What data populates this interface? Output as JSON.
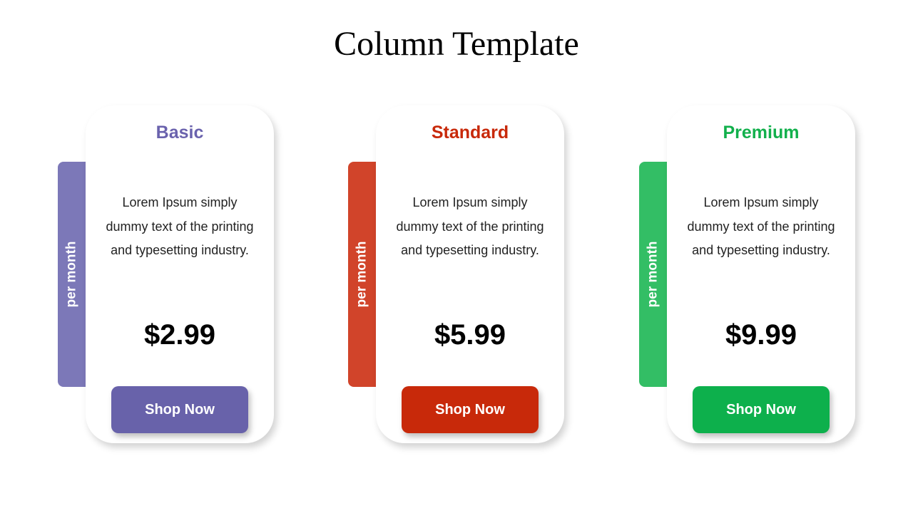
{
  "title": "Column Template",
  "plans": [
    {
      "name": "Basic",
      "period_label": "per month",
      "description": "Lorem Ipsum simply dummy text of the printing and typesetting industry.",
      "price": "$2.99",
      "button_label": "Shop Now",
      "colors": {
        "title": "#6a62ad",
        "tab": "#7c78b8",
        "button": "#6862aa"
      }
    },
    {
      "name": "Standard",
      "period_label": "per month",
      "description": "Lorem Ipsum simply dummy text of the printing and typesetting industry.",
      "price": "$5.99",
      "button_label": "Shop Now",
      "colors": {
        "title": "#c8290a",
        "tab": "#d1442a",
        "button": "#c8290a"
      }
    },
    {
      "name": "Premium",
      "period_label": "per month",
      "description": "Lorem Ipsum simply dummy text of the printing and typesetting industry.",
      "price": "$9.99",
      "button_label": "Shop Now",
      "colors": {
        "title": "#12b04c",
        "tab": "#33be65",
        "button": "#0db04c"
      }
    }
  ]
}
